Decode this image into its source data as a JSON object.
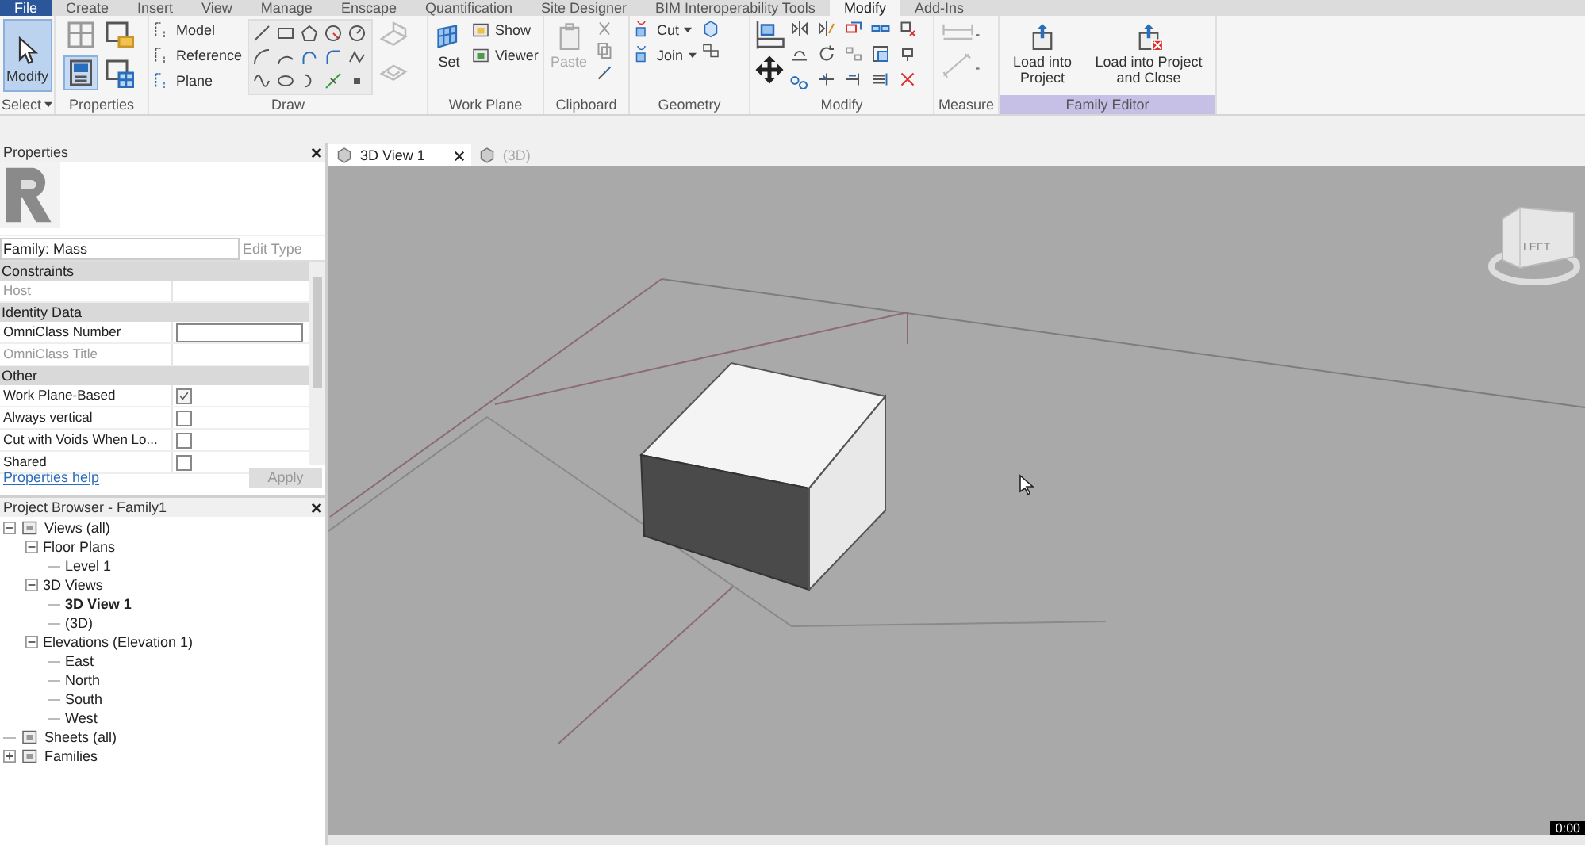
{
  "ribbon_tabs": [
    {
      "label": "File",
      "kind": "application",
      "selected": false
    },
    {
      "label": "Create",
      "kind": "tab",
      "selected": false
    },
    {
      "label": "Insert",
      "kind": "tab",
      "selected": false
    },
    {
      "label": "View",
      "kind": "tab",
      "selected": false
    },
    {
      "label": "Manage",
      "kind": "tab",
      "selected": false
    },
    {
      "label": "Enscape",
      "kind": "tab",
      "selected": false
    },
    {
      "label": "Quantification",
      "kind": "tab",
      "selected": false
    },
    {
      "label": "Site Designer",
      "kind": "tab",
      "selected": false
    },
    {
      "label": "BIM Interoperability Tools",
      "kind": "tab",
      "selected": false
    },
    {
      "label": "Modify",
      "kind": "tab",
      "selected": true
    },
    {
      "label": "Add-Ins",
      "kind": "tab",
      "selected": false
    }
  ],
  "ribbon_panels": [
    {
      "label": "Select",
      "highlighted": false,
      "buttons": [
        {
          "label": "Modify",
          "selected": true
        }
      ]
    },
    {
      "label": "Properties",
      "highlighted": false
    },
    {
      "label": "Draw",
      "highlighted": false,
      "buttons": [
        {
          "label": "Model"
        },
        {
          "label": "Reference"
        },
        {
          "label": "Plane"
        }
      ]
    },
    {
      "label": "Work Plane",
      "highlighted": false,
      "buttons": [
        {
          "label": "Set"
        },
        {
          "label": "Show"
        },
        {
          "label": "Viewer"
        }
      ]
    },
    {
      "label": "Clipboard",
      "highlighted": false,
      "buttons": [
        {
          "label": "Paste",
          "disabled": true
        }
      ]
    },
    {
      "label": "Geometry",
      "highlighted": false,
      "buttons": [
        {
          "label": "Cut"
        },
        {
          "label": "Join"
        }
      ]
    },
    {
      "label": "Modify",
      "highlighted": false
    },
    {
      "label": "Measure",
      "highlighted": false
    },
    {
      "label": "Family Editor",
      "highlighted": true,
      "buttons": [
        {
          "label": "Load into Project"
        },
        {
          "label": "Load into Project and Close"
        }
      ]
    }
  ],
  "properties": {
    "title": "Properties",
    "family": "Family: Mass",
    "edit_type": "Edit Type",
    "groups": [
      {
        "label": "Constraints",
        "rows": [
          {
            "name": "Host",
            "kind": "readonly"
          }
        ]
      },
      {
        "label": "Identity Data",
        "rows": [
          {
            "name": "OmniClass Number",
            "kind": "field"
          },
          {
            "name": "OmniClass Title",
            "kind": "readonly"
          }
        ]
      },
      {
        "label": "Other",
        "rows": [
          {
            "name": "Work Plane-Based",
            "kind": "checkbox",
            "checked": true
          },
          {
            "name": "Always vertical",
            "kind": "checkbox",
            "checked": false
          },
          {
            "name": "Cut with Voids When Lo...",
            "kind": "checkbox",
            "checked": false
          },
          {
            "name": "Shared",
            "kind": "checkbox",
            "checked": false
          }
        ]
      }
    ],
    "help_link": "Properties help",
    "apply": "Apply"
  },
  "project_browser": {
    "title": "Project Browser - Family1",
    "tree": [
      {
        "label": "Views (all)",
        "expanded": true,
        "selected": false,
        "children": [
          {
            "label": "Floor Plans",
            "expanded": true,
            "selected": false,
            "children": [
              {
                "label": "Level 1",
                "selected": false
              }
            ]
          },
          {
            "label": "3D Views",
            "expanded": true,
            "selected": false,
            "children": [
              {
                "label": "3D View 1",
                "selected": true
              },
              {
                "label": "(3D)",
                "selected": false
              }
            ]
          },
          {
            "label": "Elevations (Elevation 1)",
            "expanded": true,
            "selected": false,
            "children": [
              {
                "label": "East",
                "selected": false
              },
              {
                "label": "North",
                "selected": false
              },
              {
                "label": "South",
                "selected": false
              },
              {
                "label": "West",
                "selected": false
              }
            ]
          }
        ]
      },
      {
        "label": "Sheets (all)",
        "selected": false
      },
      {
        "label": "Families",
        "expanded": false,
        "selected": false
      }
    ]
  },
  "view_tabs": [
    {
      "label": "3D View 1",
      "selected": true
    },
    {
      "label": "(3D)",
      "selected": false
    }
  ],
  "view_cube": {
    "face": "LEFT"
  },
  "timestamp": "0:00"
}
